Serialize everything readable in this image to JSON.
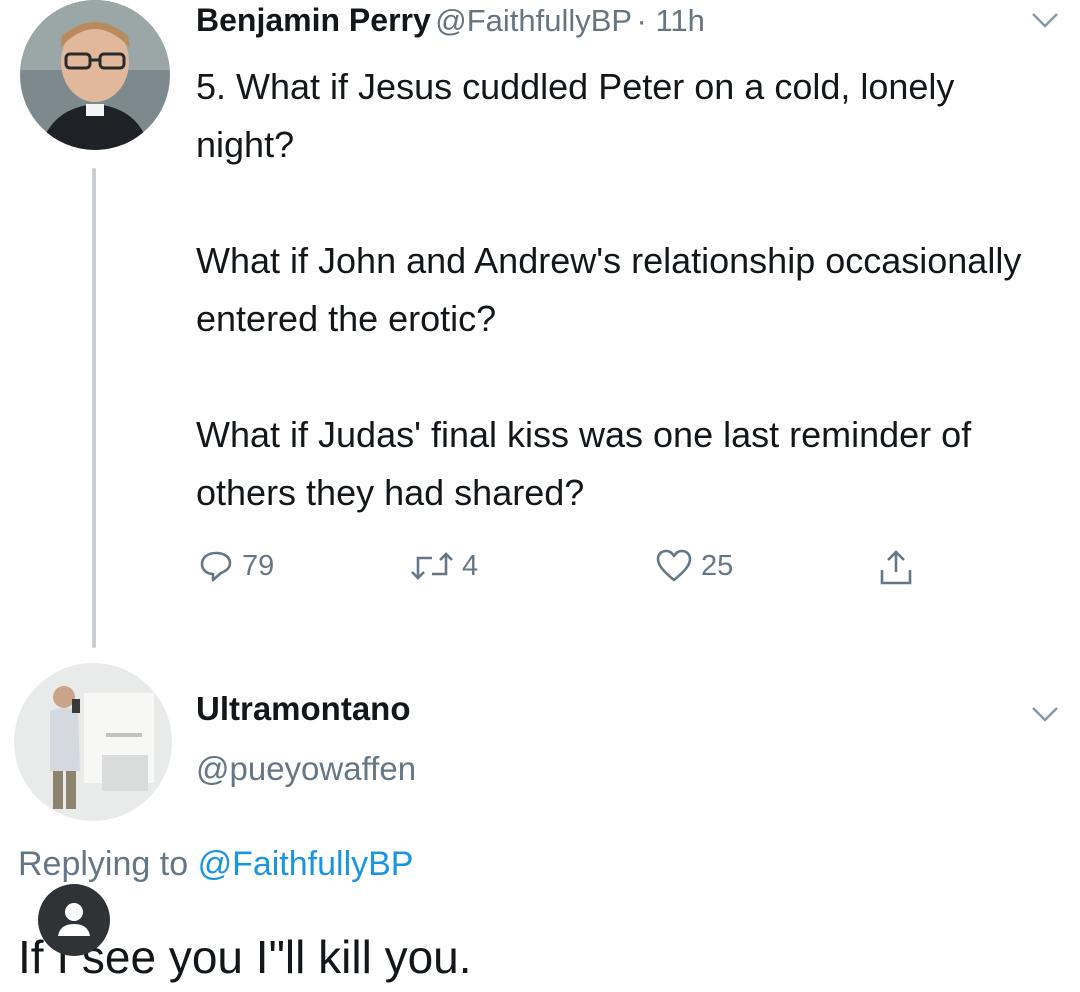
{
  "tweet": {
    "author_name": "Benjamin Perry",
    "author_handle": "@FaithfullyBP",
    "time": "· 11h",
    "paragraphs": [
      "5. What if Jesus cuddled Peter on a cold, lonely night?",
      "What if John and Andrew's relationship occasionally entered the erotic?",
      "What if Judas' final kiss was one last reminder of others they had shared?"
    ],
    "actions": {
      "replies": "79",
      "retweets": "4",
      "likes": "25"
    },
    "icons": [
      "reply-icon",
      "retweet-icon",
      "like-icon",
      "share-icon",
      "chevron-down-icon"
    ]
  },
  "reply": {
    "author_name": "Ultramontano",
    "author_handle": "@pueyowaffen",
    "replying_prefix": "Replying to",
    "replying_target": "@FaithfullyBP",
    "text": "If I see you I\"ll kill you."
  },
  "colors": {
    "link": "#1b95e0",
    "muted": "#657786",
    "text": "#14171a",
    "thread_line": "#c9ced3"
  }
}
